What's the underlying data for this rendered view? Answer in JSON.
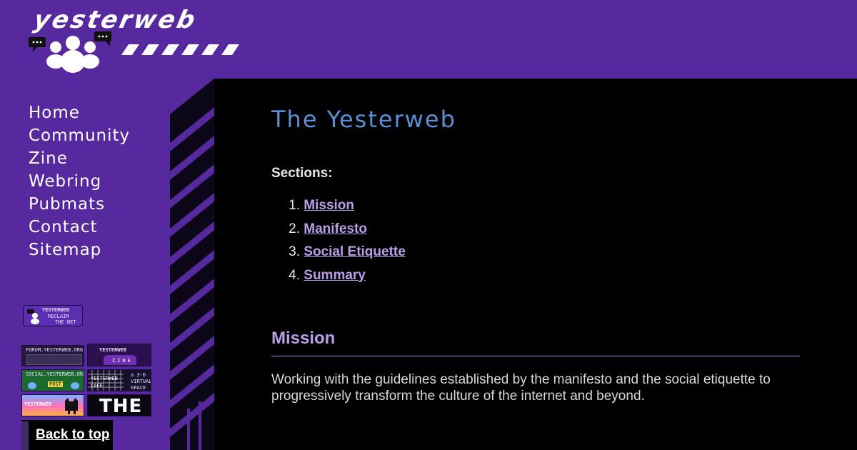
{
  "header": {
    "logo_text": "yesterweb"
  },
  "sidebar": {
    "nav": [
      {
        "label": "Home"
      },
      {
        "label": "Community"
      },
      {
        "label": "Zine"
      },
      {
        "label": "Webring"
      },
      {
        "label": "Pubmats"
      },
      {
        "label": "Contact"
      },
      {
        "label": "Sitemap"
      }
    ],
    "badges": {
      "reclaim": {
        "line1": "YESTERWEB",
        "line2": "RECLAIM",
        "line3": "THE NET"
      },
      "forum": {
        "label": "FORUM.YESTERWEB.ORG"
      },
      "zine": {
        "line1": "YESTERWEB",
        "line2": "ZINE"
      },
      "social": {
        "label": "SOCIAL.YESTERWEB.ORG",
        "post": "POST"
      },
      "cafe": {
        "line1": "YESTERWEB",
        "line2": "CAFE",
        "line3": "a 3-D",
        "line4": "VIRTUAL",
        "line5": "SPACE"
      },
      "yesterweb": {
        "label": "YESTERWEB"
      },
      "the": {
        "label": "THE"
      }
    },
    "back_to_top": "Back to top"
  },
  "main": {
    "title": "The Yesterweb",
    "sections_label": "Sections:",
    "toc": [
      {
        "num": "1.",
        "label": "Mission"
      },
      {
        "num": "2.",
        "label": "Manifesto"
      },
      {
        "num": "3.",
        "label": "Social Etiquette"
      },
      {
        "num": "4.",
        "label": "Summary"
      }
    ],
    "mission_heading": "Mission",
    "mission_text": "Working with the guidelines established by the manifesto and the social etiquette to progressively transform the culture of the internet and beyond."
  },
  "colors": {
    "background_purple": "#56299e",
    "main_black": "#000000",
    "title_blue": "#5c8fd6",
    "link_lavender": "#b7a0e8"
  }
}
